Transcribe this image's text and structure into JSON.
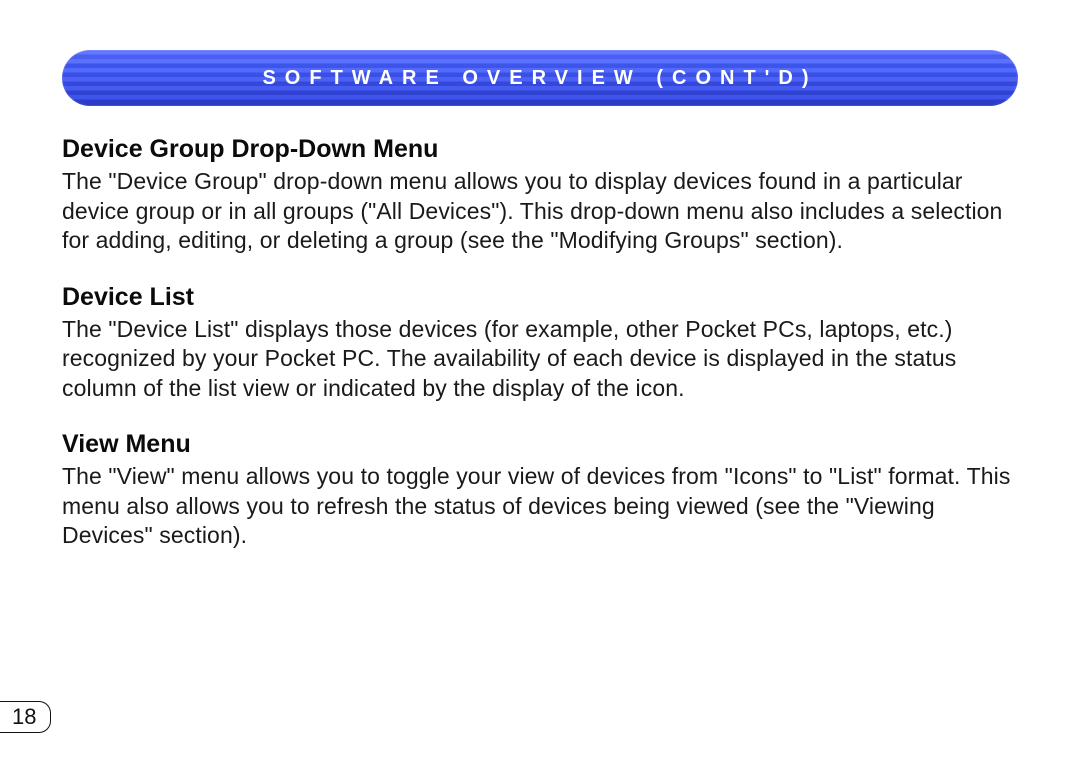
{
  "header": {
    "title": "SOFTWARE OVERVIEW (CONT'D)"
  },
  "sections": [
    {
      "heading": "Device Group Drop-Down Menu",
      "body": "The \"Device Group\" drop-down menu allows you to display devices found in a particular device group or in all groups (\"All Devices\"). This drop-down menu also includes a selection for adding, editing, or deleting a group (see the \"Modifying Groups\" section)."
    },
    {
      "heading": "Device List",
      "body": "The \"Device List\" displays those devices (for example, other Pocket PCs, laptops, etc.) recognized by your Pocket PC. The availability of each device is displayed in the status column of the list view or indicated by the display of the icon."
    },
    {
      "heading": "View Menu",
      "body": "The \"View\" menu allows you to toggle your view of devices from \"Icons\" to \"List\" format. This menu also allows you to refresh the status of devices being viewed (see the \"Viewing Devices\" section)."
    }
  ],
  "page_number": "18"
}
